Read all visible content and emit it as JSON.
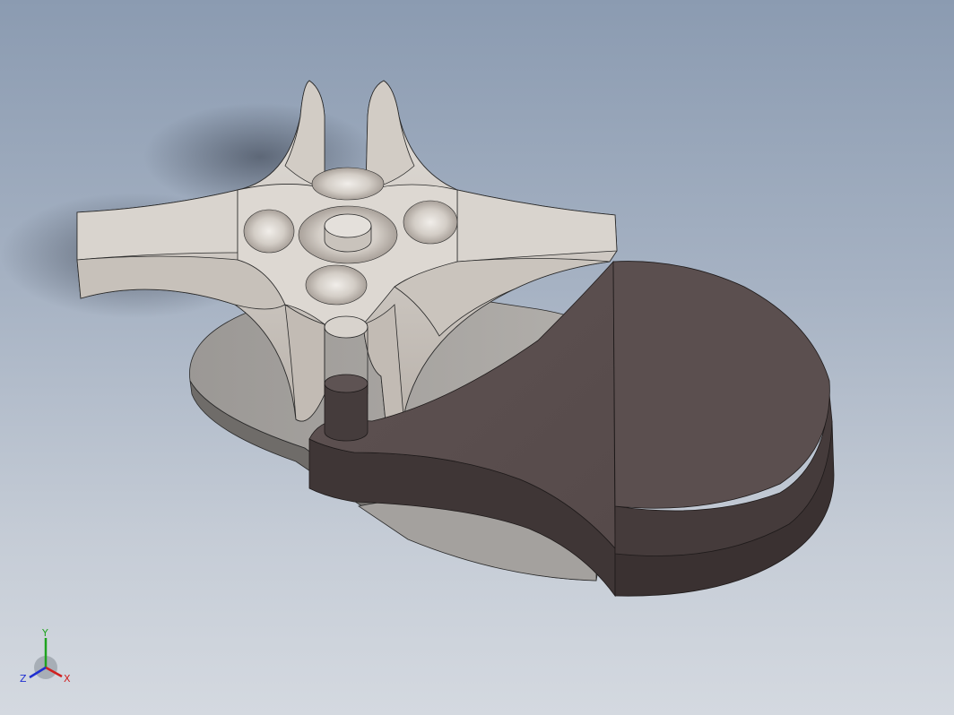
{
  "axes": {
    "x_label": "X",
    "y_label": "Y",
    "z_label": "Z",
    "x_color": "#d11f1f",
    "y_color": "#1fa31f",
    "z_color": "#1f2fd1"
  },
  "colors": {
    "background_top": "#8b9bb1",
    "background_bottom": "#d4d9e0",
    "spider_fill": "#d8d3cd",
    "spider_shade": "#b8b1aa",
    "base_plate": "#a9a7a4",
    "dark_disc": "#5a4e4e",
    "dark_side": "#3f3636",
    "edge_line": "#2a2a2a"
  }
}
